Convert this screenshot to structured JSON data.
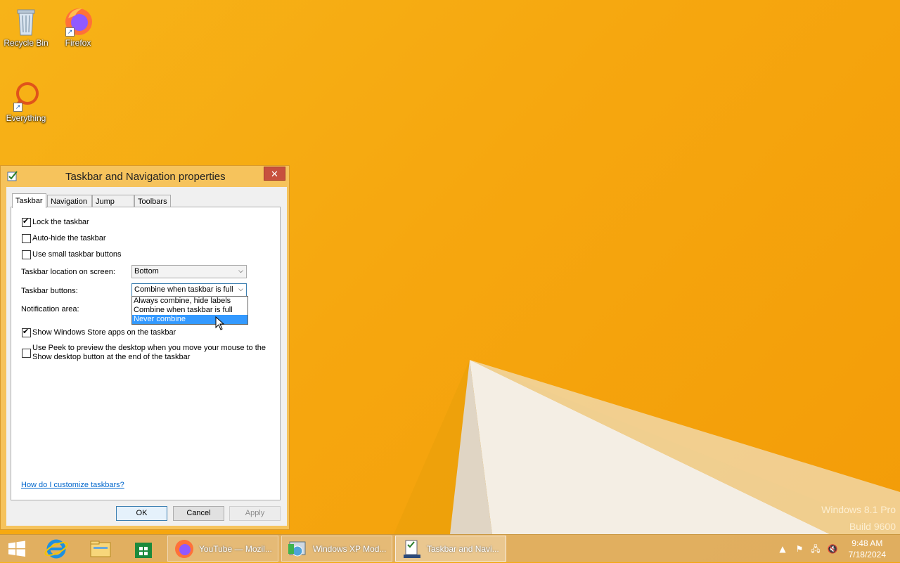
{
  "desktop": {
    "icons": [
      {
        "label": "Recycle Bin"
      },
      {
        "label": "Firefox"
      },
      {
        "label": "Everything"
      }
    ],
    "watermark_line1": "Windows 8.1 Pro",
    "watermark_line2": "Build 9600"
  },
  "dialog": {
    "title": "Taskbar and Navigation properties",
    "close_label": "✕",
    "tabs": [
      {
        "label": "Taskbar",
        "active": true
      },
      {
        "label": "Navigation"
      },
      {
        "label": "Jump Lists"
      },
      {
        "label": "Toolbars"
      }
    ],
    "checkboxes": [
      {
        "label": "Lock the taskbar",
        "checked": true
      },
      {
        "label": "Auto-hide the taskbar",
        "checked": false
      },
      {
        "label": "Use small taskbar buttons",
        "checked": false
      }
    ],
    "location_label": "Taskbar location on screen:",
    "location_value": "Bottom",
    "buttons_label": "Taskbar buttons:",
    "buttons_value": "Combine when taskbar is full",
    "buttons_options": [
      "Always combine, hide labels",
      "Combine when taskbar is full",
      "Never combine"
    ],
    "buttons_highlighted": "Never combine",
    "notification_label": "Notification area:",
    "store_apps_label": "Show Windows Store apps on the taskbar",
    "store_apps_checked": true,
    "peek_label_line1": "Use Peek to preview the desktop when you move your mouse to the",
    "peek_label_line2": "Show desktop button at the end of the taskbar",
    "peek_checked": false,
    "help_link": "How do I customize taskbars?",
    "ok_label": "OK",
    "cancel_label": "Cancel",
    "apply_label": "Apply"
  },
  "taskbar": {
    "windows": [
      {
        "label": "YouTube — Mozil..."
      },
      {
        "label": "Windows XP Mod..."
      },
      {
        "label": "Taskbar and Navi...",
        "active": true
      }
    ],
    "clock_time": "9:48 AM",
    "clock_date": "7/18/2024"
  },
  "colors": {
    "wallpaper": "#f6a70f",
    "selection": "#3399ff",
    "link": "#0066cc"
  }
}
